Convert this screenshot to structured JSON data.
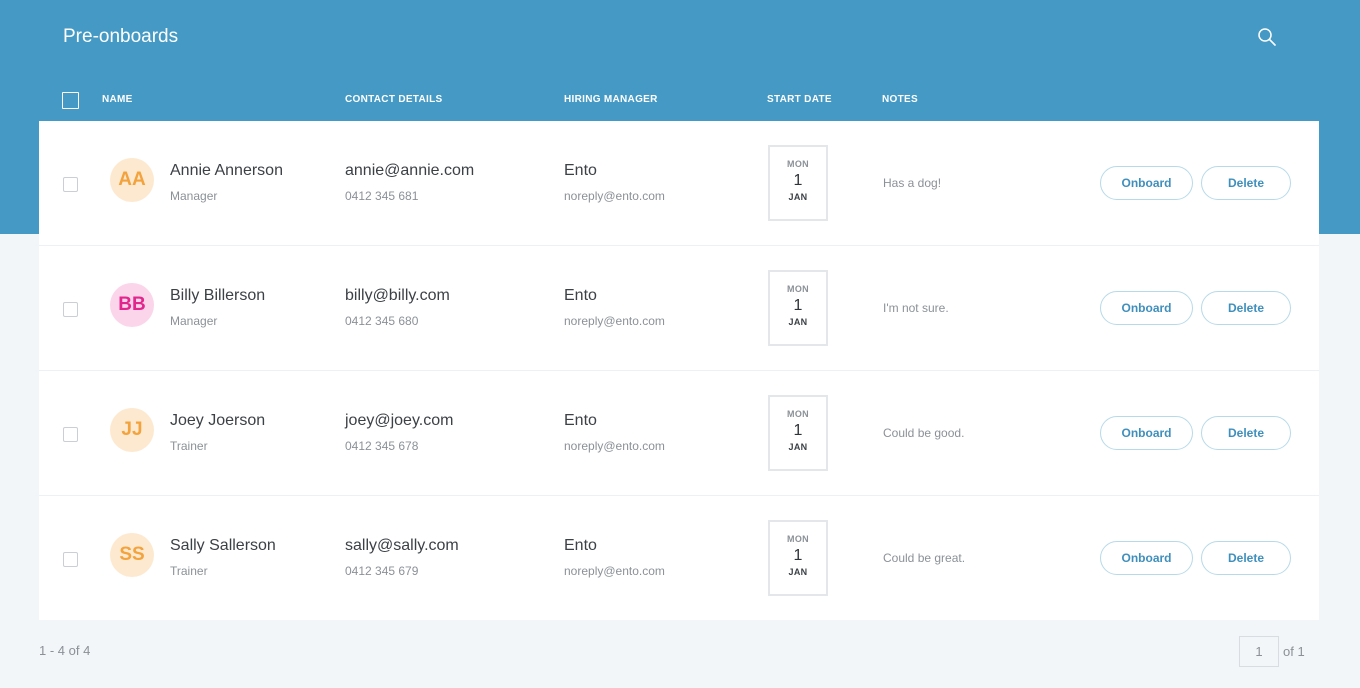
{
  "header": {
    "title": "Pre-onboards",
    "search_icon": "search-icon",
    "background_color": "#4499c5"
  },
  "columns": {
    "name": "NAME",
    "contact": "CONTACT DETAILS",
    "manager": "HIRING MANAGER",
    "start_date": "START DATE",
    "notes": "NOTES"
  },
  "rows": [
    {
      "initials": "AA",
      "avatar_color": "orange",
      "name": "Annie Annerson",
      "role": "Manager",
      "email": "annie@annie.com",
      "phone": "0412 345 681",
      "manager_name": "Ento",
      "manager_email": "noreply@ento.com",
      "date_dow": "MON",
      "date_day": "1",
      "date_month": "JAN",
      "notes": "Has a dog!",
      "onboard_label": "Onboard",
      "delete_label": "Delete"
    },
    {
      "initials": "BB",
      "avatar_color": "pink",
      "name": "Billy Billerson",
      "role": "Manager",
      "email": "billy@billy.com",
      "phone": "0412 345 680",
      "manager_name": "Ento",
      "manager_email": "noreply@ento.com",
      "date_dow": "MON",
      "date_day": "1",
      "date_month": "JAN",
      "notes": "I'm not sure.",
      "onboard_label": "Onboard",
      "delete_label": "Delete"
    },
    {
      "initials": "JJ",
      "avatar_color": "orange",
      "name": "Joey Joerson",
      "role": "Trainer",
      "email": "joey@joey.com",
      "phone": "0412 345 678",
      "manager_name": "Ento",
      "manager_email": "noreply@ento.com",
      "date_dow": "MON",
      "date_day": "1",
      "date_month": "JAN",
      "notes": "Could be good.",
      "onboard_label": "Onboard",
      "delete_label": "Delete"
    },
    {
      "initials": "SS",
      "avatar_color": "orange",
      "name": "Sally Sallerson",
      "role": "Trainer",
      "email": "sally@sally.com",
      "phone": "0412 345 679",
      "manager_name": "Ento",
      "manager_email": "noreply@ento.com",
      "date_dow": "MON",
      "date_day": "1",
      "date_month": "JAN",
      "notes": "Could be great.",
      "onboard_label": "Onboard",
      "delete_label": "Delete"
    }
  ],
  "pagination": {
    "range": "1 - 4 of 4",
    "current_page": "1",
    "total": "of 1"
  }
}
